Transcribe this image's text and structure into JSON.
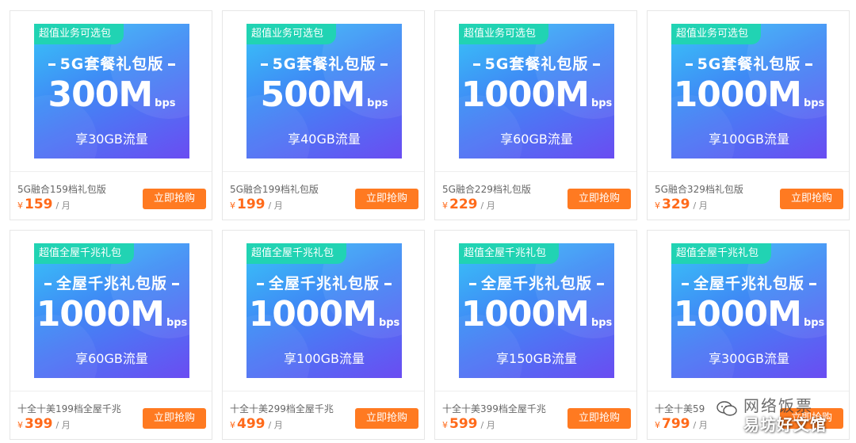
{
  "colors": {
    "banner_gradient": [
      "#38c6f8",
      "#3f8af5",
      "#6a4cf2"
    ],
    "tag_bg": "#21d3b3",
    "price": "#ff6a1a",
    "buy_button": "#ff7a21"
  },
  "row1": [
    {
      "tag": "超值业务可选包",
      "subtitle": "5G套餐礼包版",
      "speed": "300M",
      "unit": "bps",
      "flow": "享30GB流量",
      "name": "5G融合159档礼包版",
      "currency": "¥",
      "price": "159",
      "per": "/ 月",
      "buy": "立即抢购"
    },
    {
      "tag": "超值业务可选包",
      "subtitle": "5G套餐礼包版",
      "speed": "500M",
      "unit": "bps",
      "flow": "享40GB流量",
      "name": "5G融合199档礼包版",
      "currency": "¥",
      "price": "199",
      "per": "/ 月",
      "buy": "立即抢购"
    },
    {
      "tag": "超值业务可选包",
      "subtitle": "5G套餐礼包版",
      "speed": "1000M",
      "unit": "bps",
      "flow": "享60GB流量",
      "name": "5G融合229档礼包版",
      "currency": "¥",
      "price": "229",
      "per": "/ 月",
      "buy": "立即抢购"
    },
    {
      "tag": "超值业务可选包",
      "subtitle": "5G套餐礼包版",
      "speed": "1000M",
      "unit": "bps",
      "flow": "享100GB流量",
      "name": "5G融合329档礼包版",
      "currency": "¥",
      "price": "329",
      "per": "/ 月",
      "buy": "立即抢购"
    }
  ],
  "row2": [
    {
      "tag": "超值全屋千兆礼包",
      "subtitle": "全屋千兆礼包版",
      "speed": "1000M",
      "unit": "bps",
      "flow": "享60GB流量",
      "name": "十全十美199档全屋千兆",
      "currency": "¥",
      "price": "399",
      "per": "/ 月",
      "buy": "立即抢购"
    },
    {
      "tag": "超值全屋千兆礼包",
      "subtitle": "全屋千兆礼包版",
      "speed": "1000M",
      "unit": "bps",
      "flow": "享100GB流量",
      "name": "十全十美299档全屋千兆",
      "currency": "¥",
      "price": "499",
      "per": "/ 月",
      "buy": "立即抢购"
    },
    {
      "tag": "超值全屋千兆礼包",
      "subtitle": "全屋千兆礼包版",
      "speed": "1000M",
      "unit": "bps",
      "flow": "享150GB流量",
      "name": "十全十美399档全屋千兆",
      "currency": "¥",
      "price": "599",
      "per": "/ 月",
      "buy": "立即抢购"
    },
    {
      "tag": "超值全屋千兆礼包",
      "subtitle": "全屋千兆礼包版",
      "speed": "1000M",
      "unit": "bps",
      "flow": "享300GB流量",
      "name": "十全十美59",
      "currency": "¥",
      "price": "799",
      "per": "/ 月",
      "buy": "立即抢购"
    }
  ],
  "watermark": {
    "line1": "网络饭票",
    "line2": "易坊好文馆",
    "icon": "wechat-icon"
  }
}
